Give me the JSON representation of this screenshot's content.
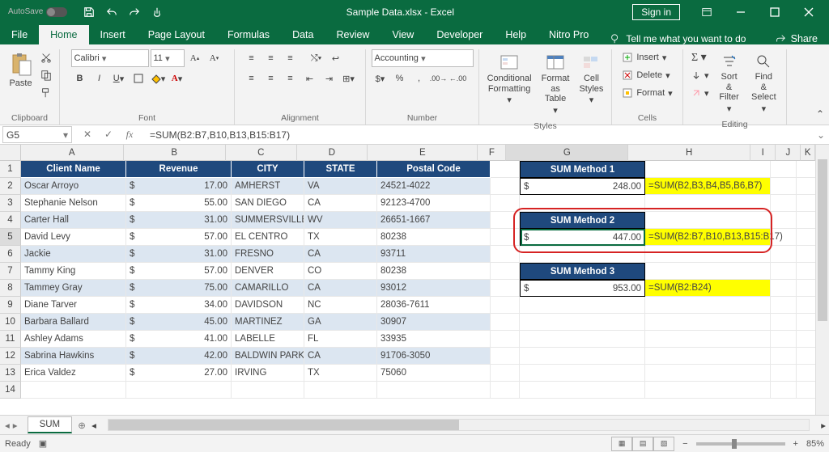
{
  "titlebar": {
    "autosave": "AutoSave",
    "title": "Sample Data.xlsx - Excel",
    "signin": "Sign in"
  },
  "tabs": {
    "items": [
      "File",
      "Home",
      "Insert",
      "Page Layout",
      "Formulas",
      "Data",
      "Review",
      "View",
      "Developer",
      "Help",
      "Nitro Pro"
    ],
    "active_index": 1,
    "tellme": "Tell me what you want to do",
    "share": "Share"
  },
  "ribbon": {
    "clipboard": {
      "paste": "Paste",
      "label": "Clipboard"
    },
    "font": {
      "family": "Calibri",
      "size": "11",
      "label": "Font"
    },
    "alignment": {
      "label": "Alignment"
    },
    "number": {
      "format": "Accounting",
      "label": "Number"
    },
    "styles": {
      "conditional": "Conditional\nFormatting",
      "table": "Format as\nTable",
      "cell": "Cell\nStyles",
      "label": "Styles"
    },
    "cells": {
      "insert": "Insert",
      "delete": "Delete",
      "format": "Format",
      "label": "Cells"
    },
    "editing": {
      "sort": "Sort &\nFilter",
      "find": "Find &\nSelect",
      "label": "Editing"
    }
  },
  "formula": {
    "name_box": "G5",
    "formula": "=SUM(B2:B7,B10,B13,B15:B17)"
  },
  "columns": {
    "letters": [
      "A",
      "B",
      "C",
      "D",
      "E",
      "F",
      "G",
      "H",
      "I",
      "J",
      "K"
    ],
    "widths": [
      130,
      130,
      90,
      90,
      140,
      36,
      155,
      155,
      32,
      32,
      18
    ],
    "active_index": 6
  },
  "active_row": 5,
  "table": {
    "headers": [
      "Client Name",
      "Revenue",
      "CITY",
      "STATE",
      "Postal Code"
    ],
    "rows": [
      {
        "n": 2,
        "client": "Oscar Arroyo",
        "rev": "17.00",
        "city": "AMHERST",
        "state": "VA",
        "postal": "24521-4022"
      },
      {
        "n": 3,
        "client": "Stephanie Nelson",
        "rev": "55.00",
        "city": "SAN DIEGO",
        "state": "CA",
        "postal": "92123-4700"
      },
      {
        "n": 4,
        "client": "Carter Hall",
        "rev": "31.00",
        "city": "SUMMERSVILLE",
        "state": "WV",
        "postal": "26651-1667"
      },
      {
        "n": 5,
        "client": "David Levy",
        "rev": "57.00",
        "city": "EL CENTRO",
        "state": "TX",
        "postal": "80238"
      },
      {
        "n": 6,
        "client": "Jackie",
        "rev": "31.00",
        "city": "FRESNO",
        "state": "CA",
        "postal": "93711"
      },
      {
        "n": 7,
        "client": "Tammy King",
        "rev": "57.00",
        "city": "DENVER",
        "state": "CO",
        "postal": "80238"
      },
      {
        "n": 8,
        "client": "Tammey Gray",
        "rev": "75.00",
        "city": "CAMARILLO",
        "state": "CA",
        "postal": "93012"
      },
      {
        "n": 9,
        "client": "Diane Tarver",
        "rev": "34.00",
        "city": "DAVIDSON",
        "state": "NC",
        "postal": "28036-7611"
      },
      {
        "n": 10,
        "client": "Barbara Ballard",
        "rev": "45.00",
        "city": "MARTINEZ",
        "state": "GA",
        "postal": "30907"
      },
      {
        "n": 11,
        "client": "Ashley Adams",
        "rev": "41.00",
        "city": "LABELLE",
        "state": "FL",
        "postal": "33935"
      },
      {
        "n": 12,
        "client": "Sabrina Hawkins",
        "rev": "42.00",
        "city": "BALDWIN PARK",
        "state": "CA",
        "postal": "91706-3050"
      },
      {
        "n": 13,
        "client": "Erica Valdez",
        "rev": "27.00",
        "city": "IRVING",
        "state": "TX",
        "postal": "75060"
      }
    ]
  },
  "sum_methods": [
    {
      "title": "SUM Method 1",
      "value": "248.00",
      "formula": "=SUM(B2,B3,B4,B5,B6,B7)",
      "row_t": 1,
      "row_v": 2
    },
    {
      "title": "SUM Method 2",
      "value": "447.00",
      "formula": "=SUM(B2:B7,B10,B13,B15:B17)",
      "row_t": 4,
      "row_v": 5
    },
    {
      "title": "SUM Method 3",
      "value": "953.00",
      "formula": "=SUM(B2:B24)",
      "row_t": 7,
      "row_v": 8
    }
  ],
  "sheets": {
    "active": "SUM"
  },
  "status": {
    "mode": "Ready",
    "zoom": "85%"
  },
  "chart_data": null
}
